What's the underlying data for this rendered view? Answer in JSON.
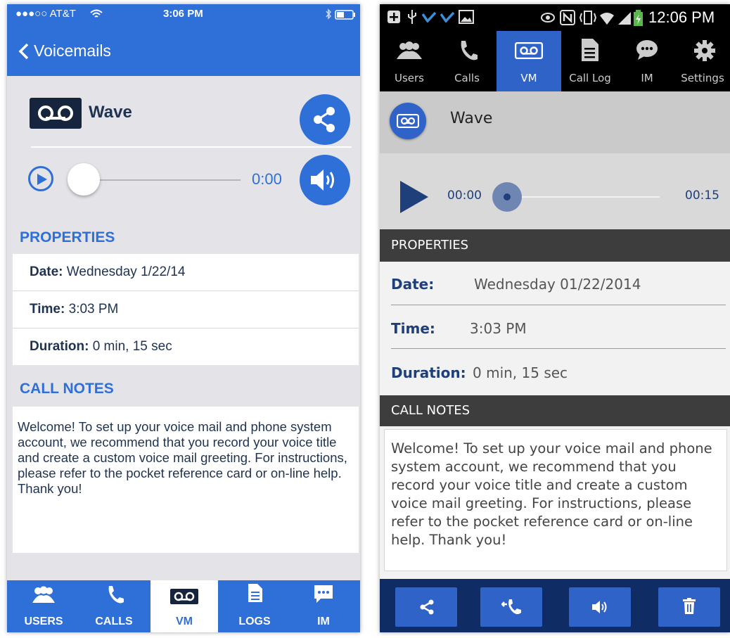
{
  "ios": {
    "status": {
      "carrier": "●●●○○ AT&T",
      "time": "3:06 PM"
    },
    "nav": {
      "back_label": "Voicemails"
    },
    "message": {
      "title": "Wave"
    },
    "player": {
      "time": "0:00",
      "progress": 0
    },
    "properties_header": "PROPERTIES",
    "properties": [
      {
        "label": "Date:",
        "value": " Wednesday 1/22/14"
      },
      {
        "label": "Time:",
        "value": " 3:03 PM"
      },
      {
        "label": "Duration:",
        "value": " 0 min, 15 sec"
      }
    ],
    "notes_header": "CALL NOTES",
    "notes": "Welcome! To set up your voice mail and phone system account, we recommend that you record your voice title and create a custom voice mail greeting. For instructions, please refer to the pocket reference card or on-line help. Thank you!",
    "tabs": [
      {
        "label": "USERS",
        "icon": "users-icon"
      },
      {
        "label": "CALLS",
        "icon": "phone-icon"
      },
      {
        "label": "VM",
        "icon": "voicemail-icon",
        "active": true
      },
      {
        "label": "LOGS",
        "icon": "document-icon"
      },
      {
        "label": "IM",
        "icon": "chat-icon"
      }
    ],
    "colors": {
      "accent": "#2f6fd8",
      "text": "#1f3351"
    }
  },
  "android": {
    "status": {
      "time": "12:06 PM"
    },
    "tabs": [
      {
        "label": "Users",
        "icon": "users-icon"
      },
      {
        "label": "Calls",
        "icon": "phone-icon"
      },
      {
        "label": "VM",
        "icon": "voicemail-icon",
        "active": true
      },
      {
        "label": "Call Log",
        "icon": "document-icon"
      },
      {
        "label": "IM",
        "icon": "chat-icon"
      },
      {
        "label": "Settings",
        "icon": "gear-icon"
      }
    ],
    "message": {
      "title": "Wave"
    },
    "player": {
      "elapsed": "00:00",
      "total": "00:15",
      "progress": 0
    },
    "properties_header": "PROPERTIES",
    "properties": [
      {
        "label": "Date:",
        "value": "Wednesday 01/22/2014"
      },
      {
        "label": "Time:",
        "value": "3:03 PM"
      },
      {
        "label": "Duration:",
        "value": "0 min, 15 sec"
      }
    ],
    "notes_header": "CALL NOTES",
    "notes": "Welcome! To set up your voice mail and phone system account, we recommend that you record your voice title and create a custom voice mail greeting. For instructions, please refer to the pocket reference card or on-line help. Thank you!",
    "actions": [
      {
        "icon": "share-icon"
      },
      {
        "icon": "call-back-icon"
      },
      {
        "icon": "speaker-icon"
      },
      {
        "icon": "trash-icon"
      }
    ],
    "colors": {
      "accent": "#2f63c7",
      "header": "#3d3d3d",
      "label": "#1e3f7a"
    }
  }
}
